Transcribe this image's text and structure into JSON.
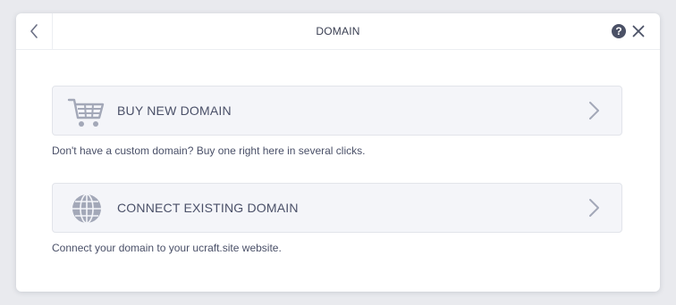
{
  "dialog": {
    "title": "DOMAIN",
    "help_glyph": "?",
    "back_icon": "chevron-left-icon",
    "close_icon": "close-icon"
  },
  "options": [
    {
      "label": "BUY NEW DOMAIN",
      "description": "Don't have a custom domain? Buy one right here in several clicks.",
      "icon": "cart-icon"
    },
    {
      "label": "CONNECT EXISTING DOMAIN",
      "description": "Connect your domain to your ucraft.site website.",
      "icon": "globe-icon"
    }
  ],
  "colors": {
    "card_background": "#f4f5f9",
    "icon_gray": "#a3a8b8",
    "text": "#4a5068",
    "help_badge": "#4b5166"
  }
}
